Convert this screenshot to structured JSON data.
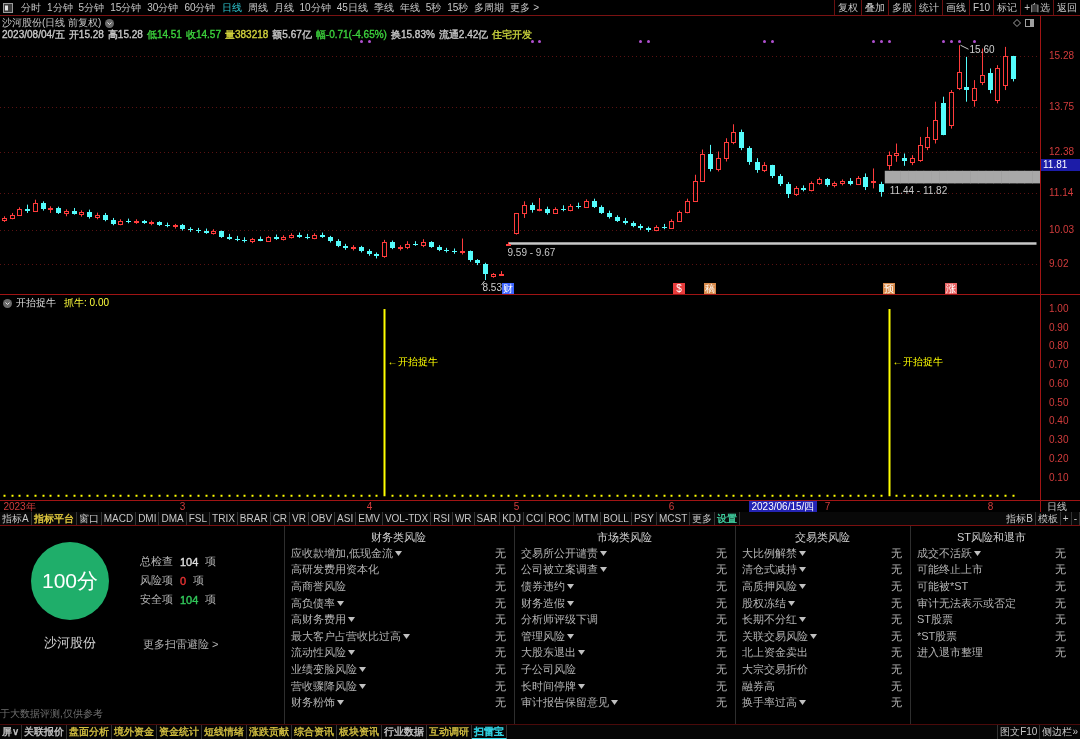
{
  "toolbar": {
    "periods": [
      {
        "label": "分时",
        "selected": false
      },
      {
        "label": "1分钟",
        "selected": false
      },
      {
        "label": "5分钟",
        "selected": false
      },
      {
        "label": "15分钟",
        "selected": false
      },
      {
        "label": "30分钟",
        "selected": false
      },
      {
        "label": "60分钟",
        "selected": false
      },
      {
        "label": "日线",
        "selected": true
      },
      {
        "label": "周线",
        "selected": false
      },
      {
        "label": "月线",
        "selected": false
      },
      {
        "label": "10分钟",
        "selected": false
      },
      {
        "label": "45日线",
        "selected": false
      },
      {
        "label": "季线",
        "selected": false
      },
      {
        "label": "年线",
        "selected": false
      },
      {
        "label": "5秒",
        "selected": false
      },
      {
        "label": "15秒",
        "selected": false
      },
      {
        "label": "多周期",
        "selected": false
      },
      {
        "label": "更多 >",
        "selected": false
      }
    ],
    "actions": [
      "复权",
      "叠加",
      "多股",
      "统计",
      "画线",
      "F10",
      "标记",
      "+自选",
      "返回"
    ]
  },
  "kline": {
    "title": "沙河股份(日线 前复权)",
    "quote": [
      {
        "text": "2023/08/04/五",
        "color": "#c8c8c8"
      },
      {
        "text": "开15.28",
        "color": "#c8c8c8"
      },
      {
        "text": "高15.28",
        "color": "#c8c8c8"
      },
      {
        "text": "低14.51",
        "color": "#3cd23c"
      },
      {
        "text": "收14.57",
        "color": "#3cd23c"
      },
      {
        "text": "量383218",
        "color": "#d2d23c"
      },
      {
        "text": "额5.67亿",
        "color": "#c8c8c8"
      },
      {
        "text": "幅-0.71(-4.65%)",
        "color": "#3cd23c"
      },
      {
        "text": "换15.83%",
        "color": "#c8c8c8"
      },
      {
        "text": "流通2.42亿",
        "color": "#c8c8c8"
      },
      {
        "text": "住宅开发",
        "color": "#c8d23c"
      }
    ],
    "event_tags": [
      {
        "text": "财",
        "color": "#3c64ff"
      },
      {
        "text": "$",
        "color": "#e83c3c"
      },
      {
        "text": "稿",
        "color": "#d88a4a"
      },
      {
        "text": "预",
        "color": "#d88a4a"
      },
      {
        "text": "涨",
        "color": "#e86464"
      }
    ],
    "cursor_price": "11.81",
    "chart_data": {
      "type": "candlestick",
      "ylim": [
        8.11,
        16.48
      ],
      "yticks": [
        15.28,
        13.75,
        12.38,
        11.14,
        10.03,
        9.02
      ],
      "grid": true,
      "ohlc": [
        [
          10.35,
          10.45,
          10.28,
          10.4
        ],
        [
          10.4,
          10.55,
          10.36,
          10.5
        ],
        [
          10.5,
          10.72,
          10.46,
          10.68
        ],
        [
          10.68,
          10.8,
          10.55,
          10.62
        ],
        [
          10.62,
          10.95,
          10.58,
          10.85
        ],
        [
          10.85,
          10.9,
          10.62,
          10.66
        ],
        [
          10.66,
          10.75,
          10.55,
          10.7
        ],
        [
          10.7,
          10.74,
          10.52,
          10.56
        ],
        [
          10.56,
          10.66,
          10.45,
          10.6
        ],
        [
          10.6,
          10.7,
          10.5,
          10.52
        ],
        [
          10.52,
          10.63,
          10.44,
          10.58
        ],
        [
          10.58,
          10.65,
          10.38,
          10.42
        ],
        [
          10.42,
          10.56,
          10.36,
          10.5
        ],
        [
          10.5,
          10.55,
          10.3,
          10.34
        ],
        [
          10.34,
          10.4,
          10.18,
          10.22
        ],
        [
          10.22,
          10.36,
          10.18,
          10.32
        ],
        [
          10.32,
          10.38,
          10.24,
          10.28
        ],
        [
          10.28,
          10.36,
          10.22,
          10.3
        ],
        [
          10.3,
          10.34,
          10.22,
          10.26
        ],
        [
          10.26,
          10.32,
          10.18,
          10.28
        ],
        [
          10.28,
          10.3,
          10.16,
          10.2
        ],
        [
          10.2,
          10.26,
          10.12,
          10.15
        ],
        [
          10.15,
          10.22,
          10.08,
          10.18
        ],
        [
          10.18,
          10.22,
          10.02,
          10.06
        ],
        [
          10.06,
          10.12,
          9.98,
          10.04
        ],
        [
          10.04,
          10.1,
          9.95,
          10.02
        ],
        [
          10.02,
          10.08,
          9.92,
          9.96
        ],
        [
          9.96,
          10.06,
          9.9,
          10.0
        ],
        [
          10.0,
          10.02,
          9.8,
          9.84
        ],
        [
          9.84,
          9.92,
          9.74,
          9.78
        ],
        [
          9.78,
          9.86,
          9.7,
          9.74
        ],
        [
          9.74,
          9.82,
          9.66,
          9.7
        ],
        [
          9.7,
          9.8,
          9.64,
          9.76
        ],
        [
          9.76,
          9.84,
          9.7,
          9.72
        ],
        [
          9.72,
          9.86,
          9.68,
          9.82
        ],
        [
          9.82,
          9.9,
          9.74,
          9.78
        ],
        [
          9.78,
          9.88,
          9.72,
          9.84
        ],
        [
          9.84,
          9.94,
          9.78,
          9.88
        ],
        [
          9.88,
          9.96,
          9.8,
          9.84
        ],
        [
          9.84,
          9.92,
          9.76,
          9.8
        ],
        [
          9.8,
          9.94,
          9.76,
          9.9
        ],
        [
          9.9,
          9.96,
          9.8,
          9.82
        ],
        [
          9.82,
          9.86,
          9.66,
          9.7
        ],
        [
          9.7,
          9.76,
          9.52,
          9.56
        ],
        [
          9.56,
          9.62,
          9.44,
          9.48
        ],
        [
          9.48,
          9.58,
          9.42,
          9.52
        ],
        [
          9.52,
          9.56,
          9.36,
          9.4
        ],
        [
          9.4,
          9.46,
          9.26,
          9.3
        ],
        [
          9.3,
          9.36,
          9.18,
          9.24
        ],
        [
          9.24,
          9.74,
          9.2,
          9.68
        ],
        [
          9.68,
          9.72,
          9.46,
          9.5
        ],
        [
          9.5,
          9.58,
          9.42,
          9.54
        ],
        [
          9.54,
          9.7,
          9.46,
          9.62
        ],
        [
          9.62,
          9.7,
          9.56,
          9.6
        ],
        [
          9.6,
          9.76,
          9.52,
          9.68
        ],
        [
          9.68,
          9.7,
          9.5,
          9.54
        ],
        [
          9.54,
          9.58,
          9.4,
          9.44
        ],
        [
          9.44,
          9.5,
          9.36,
          9.4
        ],
        [
          9.4,
          9.48,
          9.32,
          9.36
        ],
        [
          9.36,
          9.78,
          9.3,
          9.4
        ],
        [
          9.4,
          9.42,
          9.08,
          9.12
        ],
        [
          9.12,
          9.16,
          8.98,
          9.04
        ],
        [
          9.02,
          9.05,
          8.53,
          8.72
        ],
        [
          8.66,
          8.74,
          8.6,
          8.7
        ],
        [
          8.7,
          8.8,
          8.66,
          8.72
        ],
        [
          9.59,
          9.67,
          9.59,
          9.63
        ],
        [
          9.95,
          10.55,
          9.9,
          10.55
        ],
        [
          10.55,
          10.9,
          10.4,
          10.78
        ],
        [
          10.78,
          10.86,
          10.56,
          10.64
        ],
        [
          10.64,
          11.0,
          10.6,
          10.66
        ],
        [
          10.66,
          10.74,
          10.5,
          10.56
        ],
        [
          10.56,
          10.72,
          10.52,
          10.68
        ],
        [
          10.68,
          10.78,
          10.6,
          10.64
        ],
        [
          10.64,
          10.82,
          10.6,
          10.76
        ],
        [
          10.76,
          10.86,
          10.68,
          10.72
        ],
        [
          10.72,
          10.96,
          10.7,
          10.9
        ],
        [
          10.9,
          10.98,
          10.7,
          10.74
        ],
        [
          10.74,
          10.78,
          10.52,
          10.56
        ],
        [
          10.56,
          10.62,
          10.38,
          10.42
        ],
        [
          10.42,
          10.48,
          10.28,
          10.32
        ],
        [
          10.32,
          10.4,
          10.2,
          10.24
        ],
        [
          10.24,
          10.3,
          10.12,
          10.16
        ],
        [
          10.16,
          10.22,
          10.04,
          10.1
        ],
        [
          10.1,
          10.14,
          9.98,
          10.04
        ],
        [
          10.04,
          10.18,
          10.0,
          10.14
        ],
        [
          10.14,
          10.22,
          10.06,
          10.1
        ],
        [
          10.1,
          10.36,
          10.08,
          10.32
        ],
        [
          10.32,
          10.62,
          10.28,
          10.58
        ],
        [
          10.58,
          10.98,
          10.54,
          10.92
        ],
        [
          10.92,
          11.7,
          10.88,
          11.52
        ],
        [
          11.52,
          12.46,
          11.48,
          12.32
        ],
        [
          12.32,
          12.6,
          11.8,
          11.86
        ],
        [
          11.86,
          12.4,
          11.8,
          12.2
        ],
        [
          12.2,
          12.8,
          12.1,
          12.7
        ],
        [
          12.7,
          13.22,
          12.62,
          13.0
        ],
        [
          13.0,
          13.06,
          12.44,
          12.5
        ],
        [
          12.5,
          12.56,
          12.0,
          12.08
        ],
        [
          12.08,
          12.2,
          11.76,
          11.84
        ],
        [
          11.84,
          12.08,
          11.78,
          11.98
        ],
        [
          11.98,
          12.0,
          11.6,
          11.66
        ],
        [
          11.66,
          11.72,
          11.36,
          11.42
        ],
        [
          11.42,
          11.48,
          11.0,
          11.12
        ],
        [
          11.12,
          11.36,
          11.06,
          11.3
        ],
        [
          11.3,
          11.38,
          11.2,
          11.24
        ],
        [
          11.24,
          11.5,
          11.2,
          11.46
        ],
        [
          11.46,
          11.62,
          11.4,
          11.56
        ],
        [
          11.56,
          11.6,
          11.34,
          11.38
        ],
        [
          11.38,
          11.5,
          11.32,
          11.46
        ],
        [
          11.46,
          11.56,
          11.38,
          11.52
        ],
        [
          11.52,
          11.6,
          11.38,
          11.42
        ],
        [
          11.42,
          11.66,
          11.4,
          11.6
        ],
        [
          11.64,
          11.74,
          11.24,
          11.34
        ],
        [
          11.5,
          11.89,
          11.29,
          11.52
        ],
        [
          11.42,
          11.49,
          11.04,
          11.19
        ],
        [
          11.99,
          12.4,
          11.85,
          12.29
        ],
        [
          12.31,
          12.64,
          12.09,
          12.35
        ],
        [
          12.21,
          12.34,
          11.97,
          12.11
        ],
        [
          12.07,
          12.29,
          11.99,
          12.19
        ],
        [
          12.14,
          12.84,
          12.09,
          12.59
        ],
        [
          12.54,
          13.14,
          12.44,
          12.84
        ],
        [
          12.79,
          13.9,
          12.64,
          13.35
        ],
        [
          13.85,
          14.05,
          12.89,
          12.89
        ],
        [
          13.19,
          14.25,
          13.09,
          14.2
        ],
        [
          14.3,
          15.6,
          14.25,
          14.8
        ],
        [
          14.35,
          15.25,
          13.9,
          14.25
        ],
        [
          13.95,
          14.55,
          13.75,
          14.3
        ],
        [
          14.5,
          15.5,
          14.4,
          14.7
        ],
        [
          14.75,
          14.9,
          14.15,
          14.25
        ],
        [
          13.95,
          15.0,
          13.85,
          14.9
        ],
        [
          14.4,
          15.55,
          14.25,
          15.28
        ],
        [
          15.28,
          15.28,
          14.51,
          14.57
        ],
        null,
        null,
        null
      ],
      "series": [
        {
          "type": "line",
          "name": "9.59 - 9.67",
          "color": "#c8c8c8",
          "values": [
            null,
            null,
            null,
            null,
            null,
            null,
            null,
            null,
            null,
            null,
            null,
            null,
            null,
            null,
            null,
            null,
            null,
            null,
            null,
            null,
            null,
            null,
            null,
            null,
            null,
            null,
            null,
            null,
            null,
            null,
            null,
            null,
            null,
            null,
            null,
            null,
            null,
            null,
            null,
            null,
            null,
            null,
            null,
            null,
            null,
            null,
            null,
            null,
            null,
            null,
            null,
            null,
            null,
            null,
            null,
            null,
            null,
            null,
            null,
            null,
            null,
            null,
            null,
            null,
            null,
            9.63,
            9.63,
            9.63,
            9.63,
            9.63,
            9.63,
            9.63,
            9.63,
            9.63,
            9.63,
            9.63,
            9.63,
            9.63,
            9.63,
            9.63,
            9.63,
            9.63,
            9.63,
            9.63,
            9.63,
            9.63,
            9.63,
            9.63,
            9.63,
            9.63,
            9.63,
            9.63,
            9.63,
            9.63,
            9.63,
            9.63,
            9.63,
            9.63,
            9.63,
            9.63,
            9.63,
            9.63,
            9.63,
            9.63,
            9.63,
            9.63,
            9.63,
            9.63,
            9.63,
            9.63,
            9.63,
            9.63,
            9.63,
            9.63,
            9.63,
            9.63,
            9.63,
            9.63,
            9.63,
            9.63,
            9.63,
            9.63,
            9.63,
            9.63,
            9.63,
            9.63,
            9.63,
            9.63,
            9.63,
            9.63,
            9.63,
            9.63,
            9.63,
            9.63
          ]
        },
        {
          "type": "bar",
          "name": "11.44 - 11.82",
          "color": "#a8a8a8",
          "values": [
            null,
            null,
            null,
            null,
            null,
            null,
            null,
            null,
            null,
            null,
            null,
            null,
            null,
            null,
            null,
            null,
            null,
            null,
            null,
            null,
            null,
            null,
            null,
            null,
            null,
            null,
            null,
            null,
            null,
            null,
            null,
            null,
            null,
            null,
            null,
            null,
            null,
            null,
            null,
            null,
            null,
            null,
            null,
            null,
            null,
            null,
            null,
            null,
            null,
            null,
            null,
            null,
            null,
            null,
            null,
            null,
            null,
            null,
            null,
            null,
            null,
            null,
            null,
            null,
            null,
            null,
            null,
            null,
            null,
            null,
            null,
            null,
            null,
            null,
            null,
            null,
            null,
            null,
            null,
            null,
            null,
            null,
            null,
            null,
            null,
            null,
            null,
            null,
            null,
            null,
            null,
            null,
            null,
            null,
            null,
            null,
            null,
            null,
            null,
            null,
            null,
            null,
            null,
            null,
            null,
            null,
            null,
            null,
            null,
            null,
            null,
            null,
            null,
            null,
            0.38,
            0.38,
            0.38,
            0.38,
            0.38,
            0.38,
            0.38,
            0.38,
            0.38,
            0.38,
            0.38,
            0.38,
            0.38,
            0.38,
            0.38,
            0.38,
            0.38,
            0.38,
            0.38,
            0.38
          ],
          "base": [
            null,
            null,
            null,
            null,
            null,
            null,
            null,
            null,
            null,
            null,
            null,
            null,
            null,
            null,
            null,
            null,
            null,
            null,
            null,
            null,
            null,
            null,
            null,
            null,
            null,
            null,
            null,
            null,
            null,
            null,
            null,
            null,
            null,
            null,
            null,
            null,
            null,
            null,
            null,
            null,
            null,
            null,
            null,
            null,
            null,
            null,
            null,
            null,
            null,
            null,
            null,
            null,
            null,
            null,
            null,
            null,
            null,
            null,
            null,
            null,
            null,
            null,
            null,
            null,
            null,
            null,
            null,
            null,
            null,
            null,
            null,
            null,
            null,
            null,
            null,
            null,
            null,
            null,
            null,
            null,
            null,
            null,
            null,
            null,
            null,
            null,
            null,
            null,
            null,
            null,
            null,
            null,
            null,
            null,
            null,
            null,
            null,
            null,
            null,
            null,
            null,
            null,
            null,
            null,
            null,
            null,
            null,
            null,
            null,
            null,
            null,
            null,
            null,
            null,
            11.44,
            11.44,
            11.44,
            11.44,
            11.44,
            11.44,
            11.44,
            11.44,
            11.44,
            11.44,
            11.44,
            11.44,
            11.44,
            11.44,
            11.44,
            11.44,
            11.44,
            11.44,
            11.44,
            11.44
          ]
        }
      ],
      "annotations": [
        "15.60",
        "8.53"
      ]
    }
  },
  "indicator": {
    "name": "开抬捉牛",
    "readout": "抓牛: 0.00",
    "chart_data": {
      "type": "bar",
      "color": "#ffff00",
      "ylim": [
        -0.02,
        1.075
      ],
      "yticks": [
        {
          "value": 1,
          "label": "1.00"
        },
        {
          "value": 0.9,
          "label": "0.90"
        },
        {
          "value": 0.8,
          "label": "0.80"
        },
        {
          "value": 0.7,
          "label": "0.70"
        },
        {
          "value": 0.6,
          "label": "0.60"
        },
        {
          "value": 0.5,
          "label": "0.50"
        },
        {
          "value": 0.4,
          "label": "0.40"
        },
        {
          "value": 0.3,
          "label": "0.30"
        },
        {
          "value": 0.2,
          "label": "0.20"
        },
        {
          "value": 0.1,
          "label": "0.10"
        }
      ],
      "categories": [
        null,
        null,
        "2023年",
        null,
        null,
        null,
        null,
        null,
        null,
        null,
        null,
        null,
        null,
        null,
        null,
        null,
        null,
        null,
        null,
        null,
        null,
        null,
        null,
        "3",
        null,
        null,
        null,
        null,
        null,
        null,
        null,
        null,
        null,
        null,
        null,
        null,
        null,
        null,
        null,
        null,
        null,
        null,
        null,
        null,
        null,
        null,
        null,
        "4",
        null,
        null,
        null,
        null,
        null,
        null,
        null,
        null,
        null,
        null,
        null,
        null,
        null,
        null,
        null,
        null,
        null,
        null,
        "5",
        null,
        null,
        null,
        null,
        null,
        null,
        null,
        null,
        null,
        null,
        null,
        null,
        null,
        null,
        null,
        null,
        null,
        null,
        null,
        "6",
        null,
        null,
        null,
        null,
        null,
        null,
        null,
        null,
        null,
        null,
        null,
        null,
        null,
        null,
        null,
        null,
        null,
        null,
        null,
        "7",
        null,
        null,
        null,
        null,
        null,
        null,
        null,
        null,
        null,
        null,
        null,
        null,
        null,
        null,
        null,
        null,
        null,
        null,
        null,
        null,
        "8",
        null,
        null,
        null,
        null,
        null,
        null
      ],
      "values": [
        0,
        0,
        0,
        0,
        0,
        0,
        0,
        0,
        0,
        0,
        0,
        0,
        0,
        0,
        0,
        0,
        0,
        0,
        0,
        0,
        0,
        0,
        0,
        0,
        0,
        0,
        0,
        0,
        0,
        0,
        0,
        0,
        0,
        0,
        0,
        0,
        0,
        0,
        0,
        0,
        0,
        0,
        0,
        0,
        0,
        0,
        0,
        0,
        0,
        1,
        0,
        0,
        0,
        0,
        0,
        0,
        0,
        0,
        0,
        0,
        0,
        0,
        0,
        0,
        0,
        0,
        0,
        0,
        0,
        0,
        0,
        0,
        0,
        0,
        0,
        0,
        0,
        0,
        0,
        0,
        0,
        0,
        0,
        0,
        0,
        0,
        0,
        0,
        0,
        0,
        0,
        0,
        0,
        0,
        0,
        0,
        0,
        0,
        0,
        0,
        0,
        0,
        0,
        0,
        0,
        0,
        0,
        0,
        0,
        0,
        0,
        0,
        0,
        0,
        1,
        0,
        0,
        0,
        0,
        0,
        0,
        0,
        0,
        0,
        0,
        0,
        0,
        0,
        0,
        0,
        0,
        null,
        null,
        null
      ],
      "annotations": [
        "←开抬捉牛",
        "←开抬捉牛"
      ]
    }
  },
  "time_axis": {
    "cursor_label": "2023/06/15/四",
    "period": "日线"
  },
  "indicator_tabs": {
    "tabs": [
      {
        "label": "指标A"
      },
      {
        "label": "指标平台",
        "color": "#e8d040"
      },
      {
        "label": "窗口"
      },
      {
        "label": "MACD"
      },
      {
        "label": "DMI"
      },
      {
        "label": "DMA"
      },
      {
        "label": "FSL"
      },
      {
        "label": "TRIX"
      },
      {
        "label": "BRAR"
      },
      {
        "label": "CR"
      },
      {
        "label": "VR"
      },
      {
        "label": "OBV"
      },
      {
        "label": "ASI"
      },
      {
        "label": "EMV"
      },
      {
        "label": "VOL-TDX"
      },
      {
        "label": "RSI"
      },
      {
        "label": "WR"
      },
      {
        "label": "SAR"
      },
      {
        "label": "KDJ"
      },
      {
        "label": "CCI"
      },
      {
        "label": "ROC"
      },
      {
        "label": "MTM"
      },
      {
        "label": "BOLL"
      },
      {
        "label": "PSY"
      },
      {
        "label": "MCST"
      },
      {
        "label": "更多"
      },
      {
        "label": "设置",
        "color": "#40d0a0"
      }
    ],
    "right": [
      "指标B",
      "模板",
      "+",
      "-"
    ]
  },
  "risk_scan": {
    "score": "100分",
    "stock": "沙河股份",
    "stats": [
      {
        "label": "总检查",
        "value": "104",
        "unit": "项",
        "color": "#dcdcdc"
      },
      {
        "label": "风险项",
        "value": "0",
        "unit": "项",
        "color": "#e63232"
      },
      {
        "label": "安全项",
        "value": "104",
        "unit": "项",
        "color": "#32c85a"
      }
    ],
    "more_link": "更多扫雷避险 >",
    "disclaimer": "于大数据评测,仅供参考",
    "groups": [
      {
        "title": "财务类风险",
        "items": [
          {
            "name": "应收款增加,低现金流",
            "expandable": true,
            "result": "无"
          },
          {
            "name": "高研发费用资本化",
            "expandable": false,
            "result": "无"
          },
          {
            "name": "高商誉风险",
            "expandable": false,
            "result": "无"
          },
          {
            "name": "高负债率",
            "expandable": true,
            "result": "无"
          },
          {
            "name": "高财务费用",
            "expandable": true,
            "result": "无"
          },
          {
            "name": "最大客户占营收比过高",
            "expandable": true,
            "result": "无"
          },
          {
            "name": "流动性风险",
            "expandable": true,
            "result": "无"
          },
          {
            "name": "业绩变脸风险",
            "expandable": true,
            "result": "无"
          },
          {
            "name": "营收骤降风险",
            "expandable": true,
            "result": "无"
          },
          {
            "name": "财务粉饰",
            "expandable": true,
            "result": "无"
          }
        ]
      },
      {
        "title": "市场类风险",
        "items": [
          {
            "name": "交易所公开谴责",
            "expandable": true,
            "result": "无"
          },
          {
            "name": "公司被立案调查",
            "expandable": true,
            "result": "无"
          },
          {
            "name": "债券违约",
            "expandable": true,
            "result": "无"
          },
          {
            "name": "财务造假",
            "expandable": true,
            "result": "无"
          },
          {
            "name": "分析师评级下调",
            "expandable": false,
            "result": "无"
          },
          {
            "name": "管理风险",
            "expandable": true,
            "result": "无"
          },
          {
            "name": "大股东退出",
            "expandable": true,
            "result": "无"
          },
          {
            "name": "子公司风险",
            "expandable": false,
            "result": "无"
          },
          {
            "name": "长时间停牌",
            "expandable": true,
            "result": "无"
          },
          {
            "name": "审计报告保留意见",
            "expandable": true,
            "result": "无"
          }
        ]
      },
      {
        "title": "交易类风险",
        "items": [
          {
            "name": "大比例解禁",
            "expandable": true,
            "result": "无"
          },
          {
            "name": "清仓式减持",
            "expandable": true,
            "result": "无"
          },
          {
            "name": "高质押风险",
            "expandable": true,
            "result": "无"
          },
          {
            "name": "股权冻结",
            "expandable": true,
            "result": "无"
          },
          {
            "name": "长期不分红",
            "expandable": true,
            "result": "无"
          },
          {
            "name": "关联交易风险",
            "expandable": true,
            "result": "无"
          },
          {
            "name": "北上资金卖出",
            "expandable": false,
            "result": "无"
          },
          {
            "name": "大宗交易折价",
            "expandable": false,
            "result": "无"
          },
          {
            "name": "融券高",
            "expandable": false,
            "result": "无"
          },
          {
            "name": "换手率过高",
            "expandable": true,
            "result": "无"
          }
        ]
      },
      {
        "title": "ST风险和退市",
        "items": [
          {
            "name": "成交不活跃",
            "expandable": true,
            "result": "无"
          },
          {
            "name": "可能终止上市",
            "expandable": false,
            "result": "无"
          },
          {
            "name": "可能被*ST",
            "expandable": false,
            "result": "无"
          },
          {
            "name": "审计无法表示或否定",
            "expandable": false,
            "result": "无"
          },
          {
            "name": "ST股票",
            "expandable": false,
            "result": "无"
          },
          {
            "name": "*ST股票",
            "expandable": false,
            "result": "无"
          },
          {
            "name": "进入退市整理",
            "expandable": false,
            "result": "无"
          }
        ]
      }
    ]
  },
  "bottom_tabs": {
    "tabs": [
      {
        "label": "屏∨",
        "selected": false,
        "color": "#c8c8c8"
      },
      {
        "label": "关联报价",
        "selected": false,
        "color": "#c8c8c8"
      },
      {
        "label": "盘面分析",
        "selected": false,
        "color": "#d4c040"
      },
      {
        "label": "境外资金",
        "selected": false,
        "color": "#d4c040"
      },
      {
        "label": "资金统计",
        "selected": false,
        "color": "#d4c040"
      },
      {
        "label": "短线情绪",
        "selected": false,
        "color": "#d4c040"
      },
      {
        "label": "涨跌贡献",
        "selected": false,
        "color": "#d4c040"
      },
      {
        "label": "综合资讯",
        "selected": false,
        "color": "#d4c040"
      },
      {
        "label": "板块资讯",
        "selected": false,
        "color": "#d4c040"
      },
      {
        "label": "行业数据",
        "selected": false,
        "color": "#c8c8c8"
      },
      {
        "label": "互动调研",
        "selected": false,
        "color": "#d4c040"
      },
      {
        "label": "扫雷宝",
        "selected": true,
        "color": "#30d0e0"
      }
    ],
    "right": [
      "图文F10",
      "侧边栏»"
    ]
  }
}
